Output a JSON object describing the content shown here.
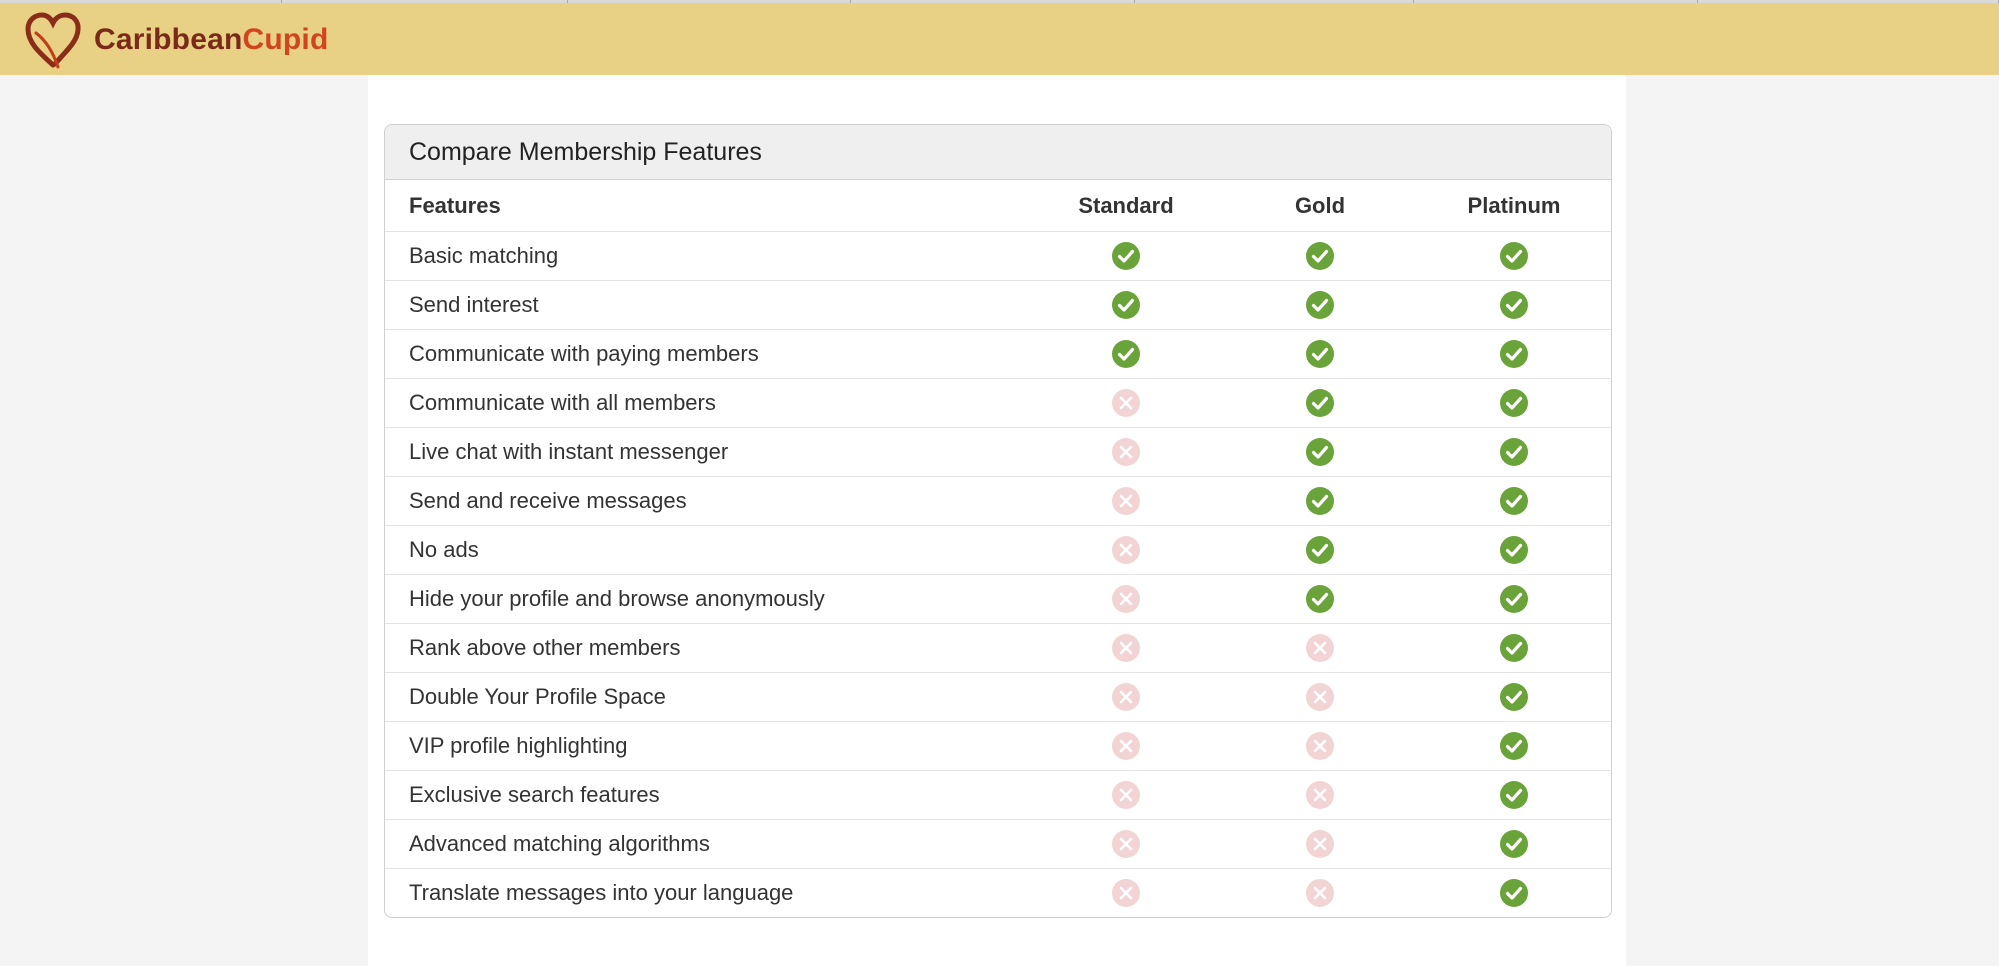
{
  "brand": {
    "name_part1": "Caribbean",
    "name_part2": "Cupid",
    "color_dark": "#7a2a18",
    "color_accent": "#d2441e",
    "header_bg": "#e8d084"
  },
  "compare": {
    "title": "Compare Membership Features",
    "columns": {
      "feature": "Features",
      "standard": "Standard",
      "gold": "Gold",
      "platinum": "Platinum"
    },
    "rows": [
      {
        "label": "Basic matching",
        "standard": true,
        "gold": true,
        "platinum": true
      },
      {
        "label": "Send interest",
        "standard": true,
        "gold": true,
        "platinum": true
      },
      {
        "label": "Communicate with paying members",
        "standard": true,
        "gold": true,
        "platinum": true
      },
      {
        "label": "Communicate with all members",
        "standard": false,
        "gold": true,
        "platinum": true
      },
      {
        "label": "Live chat with instant messenger",
        "standard": false,
        "gold": true,
        "platinum": true
      },
      {
        "label": "Send and receive messages",
        "standard": false,
        "gold": true,
        "platinum": true
      },
      {
        "label": "No ads",
        "standard": false,
        "gold": true,
        "platinum": true
      },
      {
        "label": "Hide your profile and browse anonymously",
        "standard": false,
        "gold": true,
        "platinum": true
      },
      {
        "label": "Rank above other members",
        "standard": false,
        "gold": false,
        "platinum": true
      },
      {
        "label": "Double Your Profile Space",
        "standard": false,
        "gold": false,
        "platinum": true
      },
      {
        "label": "VIP profile highlighting",
        "standard": false,
        "gold": false,
        "platinum": true
      },
      {
        "label": "Exclusive search features",
        "standard": false,
        "gold": false,
        "platinum": true
      },
      {
        "label": "Advanced matching algorithms",
        "standard": false,
        "gold": false,
        "platinum": true
      },
      {
        "label": "Translate messages into your language",
        "standard": false,
        "gold": false,
        "platinum": true
      }
    ],
    "icons": {
      "included": "check-circle-icon",
      "excluded": "x-circle-icon"
    },
    "colors": {
      "check": "#6aa33a",
      "cross": "#f3d4d4"
    }
  }
}
